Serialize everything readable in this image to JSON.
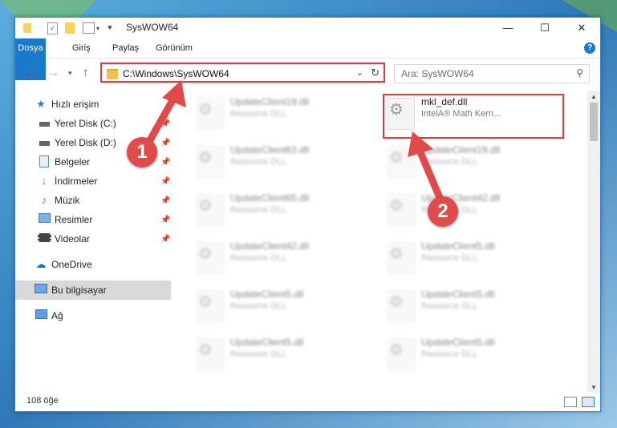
{
  "window": {
    "title": "SysWOW64",
    "controls": {
      "minimize": "—",
      "maximize": "☐",
      "close": "✕"
    }
  },
  "ribbon": {
    "tabs": [
      "Dosya",
      "Giriş",
      "Paylaş",
      "Görünüm"
    ],
    "help": "?"
  },
  "nav": {
    "address": "C:\\Windows\\SysWOW64",
    "search_placeholder": "Ara: SysWOW64"
  },
  "sidebar": {
    "items": [
      {
        "label": "Hızlı erişim",
        "icon": "star-icon",
        "pinned": false
      },
      {
        "label": "Yerel Disk (C:)",
        "icon": "drive-icon",
        "pinned": true
      },
      {
        "label": "Yerel Disk (D:)",
        "icon": "drive-icon",
        "pinned": true
      },
      {
        "label": "Belgeler",
        "icon": "documents-icon",
        "pinned": true
      },
      {
        "label": "İndirmeler",
        "icon": "download-icon",
        "pinned": true
      },
      {
        "label": "Müzik",
        "icon": "music-icon",
        "pinned": true
      },
      {
        "label": "Resimler",
        "icon": "pictures-icon",
        "pinned": true
      },
      {
        "label": "Videolar",
        "icon": "videos-icon",
        "pinned": true
      },
      {
        "label": "OneDrive",
        "icon": "cloud-icon",
        "pinned": false
      },
      {
        "label": "Bu bilgisayar",
        "icon": "computer-icon",
        "pinned": false
      },
      {
        "label": "Ağ",
        "icon": "network-icon",
        "pinned": false
      }
    ]
  },
  "files": {
    "left_column": [
      {
        "name": "UpdateClient19.dll",
        "desc": "Resource DLL"
      },
      {
        "name": "UpdateClient63.dll",
        "desc": "Resource DLL"
      },
      {
        "name": "UpdateClient65.dll",
        "desc": "Resource DLL"
      },
      {
        "name": "UpdateClient42.dll",
        "desc": "Resource DLL"
      },
      {
        "name": "UpdateClient5.dll",
        "desc": "Resource DLL"
      },
      {
        "name": "UpdateClient5.dll",
        "desc": "Resource DLL"
      }
    ],
    "right_column": [
      {
        "name": "mkl_def.dll",
        "desc": "IntelA® Math Kern..."
      },
      {
        "name": "UpdateClient19.dll",
        "desc": "Resource DLL"
      },
      {
        "name": "UpdateClient42.dll",
        "desc": "Resource DLL"
      },
      {
        "name": "UpdateClient5.dll",
        "desc": "Resource DLL"
      },
      {
        "name": "UpdateClient5.dll",
        "desc": "Resource DLL"
      },
      {
        "name": "UpdateClient5.dll",
        "desc": "Resource DLL"
      }
    ]
  },
  "status": {
    "count": "108 öğe"
  },
  "annotations": {
    "step1": "1",
    "step2": "2"
  },
  "colors": {
    "accent": "#1979ca",
    "highlight": "#e03a3a"
  }
}
